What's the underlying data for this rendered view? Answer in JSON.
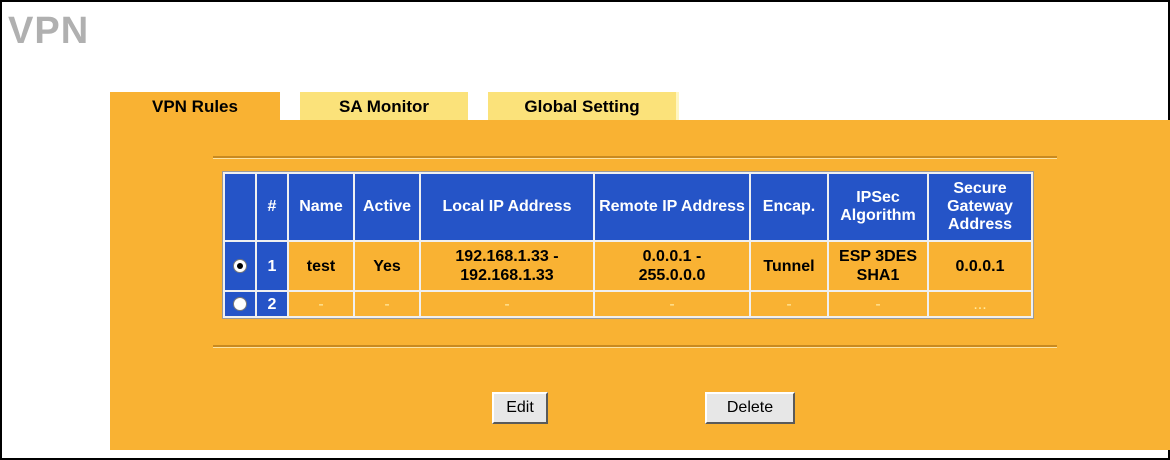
{
  "page": {
    "title": "VPN"
  },
  "tabs": [
    {
      "label": "VPN Rules",
      "active": true
    },
    {
      "label": "SA Monitor",
      "active": false
    },
    {
      "label": "Global Setting",
      "active": false
    }
  ],
  "table": {
    "headers": [
      "",
      "#",
      "Name",
      "Active",
      "Local IP Address",
      "Remote IP Address",
      "Encap.",
      "IPSec Algorithm",
      "Secure Gateway Address"
    ],
    "rows": [
      {
        "selected": true,
        "num": "1",
        "name": "test",
        "active": "Yes",
        "local_ip": [
          "192.168.1.33 -",
          "192.168.1.33"
        ],
        "remote_ip": [
          "0.0.0.1 -",
          "255.0.0.0"
        ],
        "encap": "Tunnel",
        "algorithm": [
          "ESP 3DES",
          "SHA1"
        ],
        "gateway": "0.0.0.1"
      },
      {
        "selected": false,
        "num": "2",
        "name": "-",
        "active": "-",
        "local_ip": "-",
        "remote_ip": "-",
        "encap": "-",
        "algorithm": "-",
        "gateway": "..."
      }
    ]
  },
  "buttons": {
    "edit": "Edit",
    "delete": "Delete"
  },
  "colors": {
    "panel": "#f9b233",
    "tab_inactive": "#fbe27a",
    "header": "#2554c7",
    "title": "#b0b0b0"
  }
}
